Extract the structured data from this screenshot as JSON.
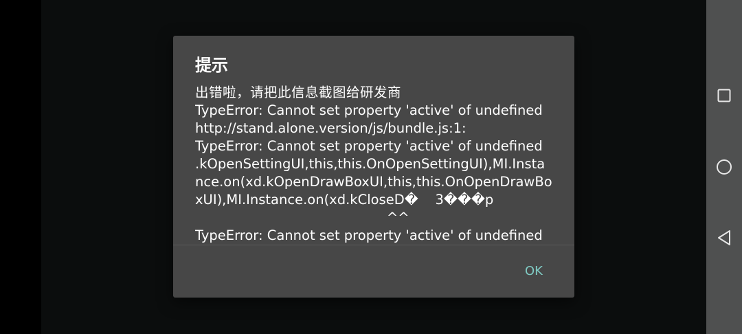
{
  "dialog": {
    "title": "提示",
    "lines": [
      "出错啦，请把此信息截图给研发商",
      "TypeError: Cannot set property 'active' of undefined",
      "http://stand.alone.version/js/bundle.js:1:",
      "TypeError: Cannot set property 'active' of undefined",
      ".kOpenSettingUI,this,this.OnOpenSettingUI),MI.Insta",
      "nce.on(xd.kOpenDrawBoxUI,this,this.OnOpenDrawBo",
      "xUI),MI.Instance.on(xd.kCloseD�    3���p",
      "                                             ^^",
      "TypeError: Cannot set property 'active' of undefined"
    ],
    "ok_label": "OK"
  },
  "nav_bar": {
    "recents_icon": "square-icon",
    "home_icon": "circle-icon",
    "back_icon": "triangle-back-icon"
  },
  "colors": {
    "dialog_bg": "#474747",
    "nav_bar_bg": "#4f5050",
    "accent": "#80cbc4",
    "text": "#ffffff"
  }
}
